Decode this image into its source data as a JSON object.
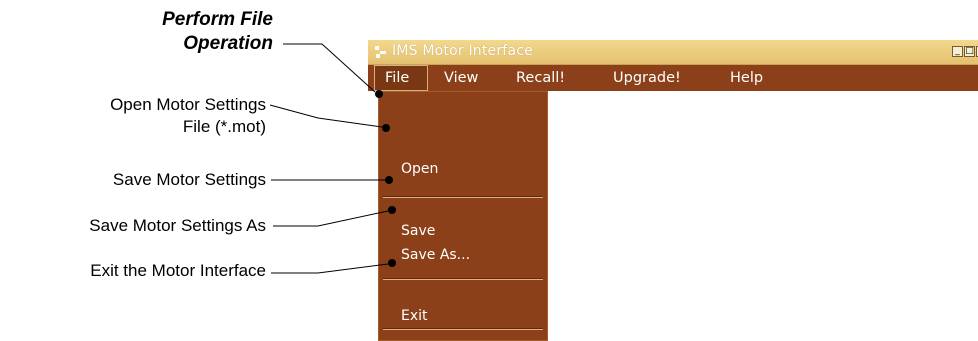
{
  "callouts": {
    "perform_line1": "Perform File",
    "perform_line2": "Operation",
    "open_line1": "Open Motor Settings",
    "open_line2": "File (*.mot)",
    "save": "Save Motor Settings",
    "save_as": "Save Motor Settings As",
    "exit": "Exit the Motor Interface"
  },
  "window": {
    "title": "IMS Motor Interface",
    "app_icon": "app-icon",
    "controls": {
      "minimize": "_",
      "maximize": "□",
      "close": "×"
    }
  },
  "menubar": {
    "items": [
      "File",
      "View",
      "Recall!",
      "Upgrade!",
      "Help"
    ],
    "active": "File"
  },
  "file_menu": {
    "items": [
      "Open",
      "Save",
      "Save As...",
      "Exit"
    ]
  },
  "colors": {
    "menu_brown": "#8b4019",
    "titlebar": "#e4c070",
    "text_light": "#ffffff"
  }
}
